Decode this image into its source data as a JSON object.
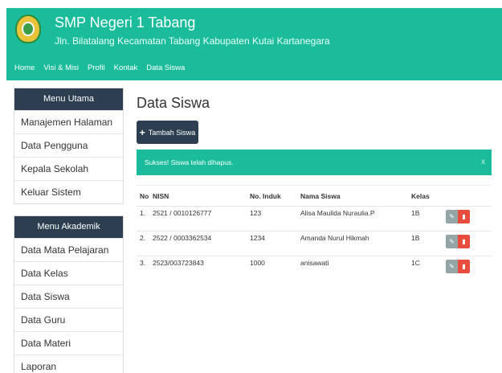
{
  "header": {
    "school_name": "SMP Negeri 1 Tabang",
    "address": "Jln. Bilatalang Kecamatan Tabang Kabupaten Kutai Kartanegara",
    "nav": [
      "Home",
      "Visi & Misi",
      "Profil",
      "Kontak",
      "Data Siswa"
    ]
  },
  "sidebar": {
    "menu_utama": {
      "title": "Menu Utama",
      "items": [
        "Manajemen Halaman",
        "Data Pengguna",
        "Kepala Sekolah",
        "Keluar Sistem"
      ]
    },
    "menu_akademik": {
      "title": "Menu Akademik",
      "items": [
        "Data Mata Pelajaran",
        "Data Kelas",
        "Data Siswa",
        "Data Guru",
        "Data Materi",
        "Laporan"
      ]
    }
  },
  "main": {
    "title": "Data Siswa",
    "add_button_label": "Tambah Siswa",
    "alert_text": "Sukses! Siswa telah dihapus.",
    "alert_close": "x",
    "table": {
      "headers": [
        "No",
        "NISN",
        "No. Induk",
        "Nama Siswa",
        "Kelas"
      ],
      "rows": [
        [
          "1.",
          "2521 / 0010126777",
          "123",
          "Alisa Maulida Nuraulia.P",
          "1B"
        ],
        [
          "2.",
          "2522 / 0003362534",
          "1234",
          "Amanda Nurul Hikmah",
          "1B"
        ],
        [
          "3.",
          "2523/003723843",
          "1000",
          "anisawati",
          "1C"
        ]
      ]
    }
  },
  "colors": {
    "primary": "#1abc9c",
    "dark": "#2c3e50",
    "danger": "#e74c3c",
    "muted": "#95a5a6"
  }
}
